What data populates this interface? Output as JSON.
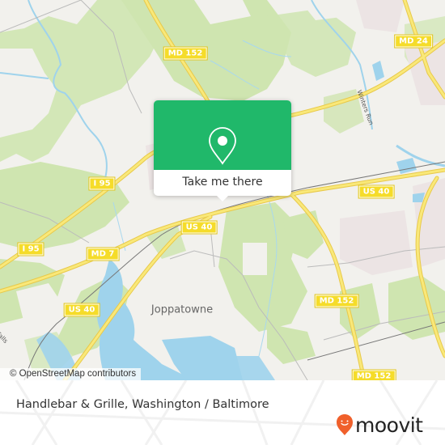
{
  "map": {
    "shields": [
      {
        "id": "md152-north",
        "label": "MD 152"
      },
      {
        "id": "md24",
        "label": "MD 24"
      },
      {
        "id": "i95-north",
        "label": "I 95"
      },
      {
        "id": "i95-south",
        "label": "I 95"
      },
      {
        "id": "md7",
        "label": "MD 7"
      },
      {
        "id": "us40-center",
        "label": "US 40"
      },
      {
        "id": "us40-east",
        "label": "US 40"
      },
      {
        "id": "us40-west",
        "label": "US 40"
      },
      {
        "id": "md152-mid",
        "label": "MD 152"
      },
      {
        "id": "md152-south",
        "label": "MD 152"
      }
    ],
    "places": [
      {
        "id": "joppatowne",
        "label": "Joppatowne"
      }
    ],
    "road_labels": [
      {
        "id": "winters-run",
        "label": "Winters Run"
      },
      {
        "id": "falls",
        "label": "Falls"
      }
    ],
    "colors": {
      "land": "#f2f1ed",
      "forest": "#cfe5b0",
      "water": "#9fd3ec",
      "highway": "#f6df58",
      "urban": "#ece4e4"
    }
  },
  "popup": {
    "button_label": "Take me there",
    "icon": "map-pin-icon",
    "accent_color": "#20b86a"
  },
  "attribution": {
    "text": "© OpenStreetMap contributors"
  },
  "footer": {
    "title": "Handlebar & Grille, Washington / Baltimore",
    "brand": "moovit",
    "brand_color": "#f0602b"
  }
}
